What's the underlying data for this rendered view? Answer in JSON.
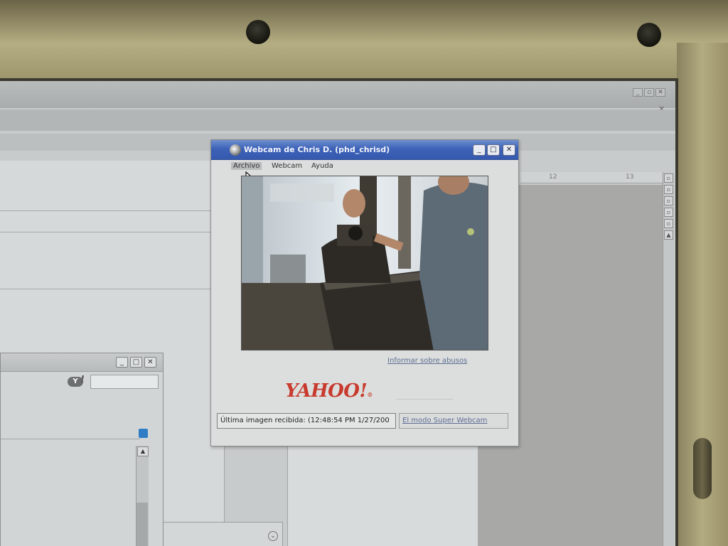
{
  "webcam_window": {
    "title": "Webcam de Chris D. (phd_chrisd)",
    "menu": [
      "Archivo",
      "Webcam",
      "Ayuda"
    ],
    "abuse_link": "Informar sobre abusos",
    "brand": "YAHOO!",
    "status_last_image": "Última imagen recibida: (12:48:54 PM 1/27/200",
    "super_webcam_link": "El modo Super Webcam",
    "minimize": "_",
    "maximize": "□",
    "close": "✕"
  },
  "background_app": {
    "ruler_labels": [
      "12",
      "13"
    ],
    "scroll_buttons": [
      "▫",
      "▫",
      "▫",
      "▫",
      "▫",
      "▲"
    ],
    "collapse_symbol": "⌄",
    "menu_buttons": [
      "_",
      "▫",
      "✕"
    ],
    "close_x": "×"
  },
  "messenger_window": {
    "yahoo_badge": "Y",
    "exclamation": "!",
    "scroll_up": "▲",
    "minimize": "_",
    "maximize": "□",
    "close": "✕"
  },
  "colors": {
    "title_bar": "#3d62b8",
    "yahoo_red": "#c83a2e",
    "link": "#5d6e93"
  }
}
